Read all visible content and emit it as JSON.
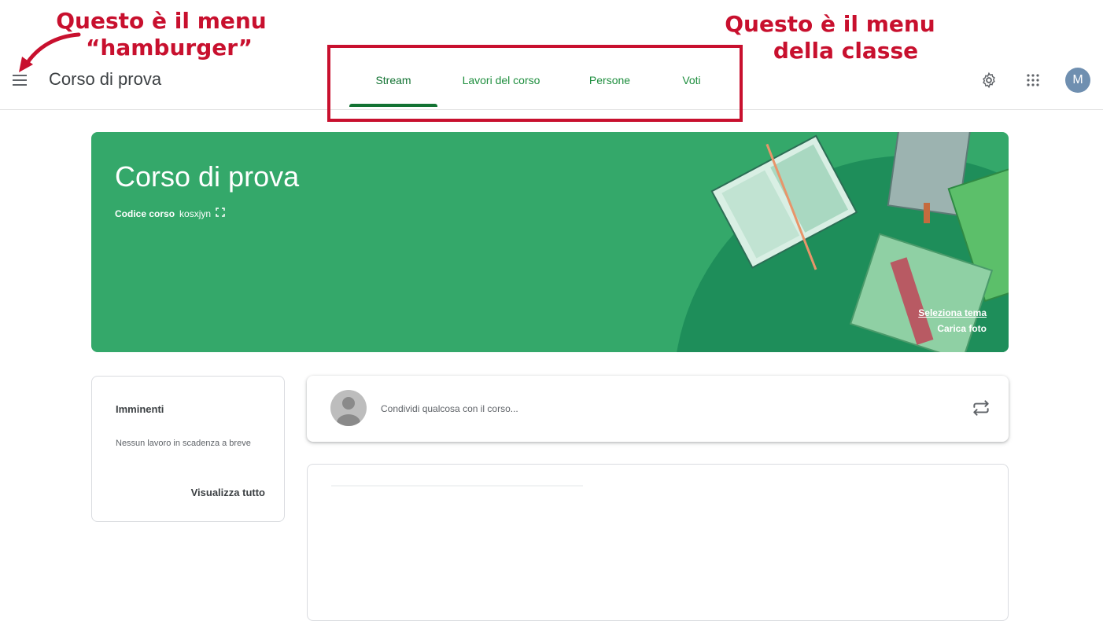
{
  "annotations": {
    "hamburger_line1": "Questo è il menu",
    "hamburger_line2": "“hamburger”",
    "class_menu_line1": "Questo è il menu",
    "class_menu_line2": "della classe"
  },
  "header": {
    "course_title": "Corso di prova",
    "tabs": [
      {
        "label": "Stream",
        "active": true
      },
      {
        "label": "Lavori del corso",
        "active": false
      },
      {
        "label": "Persone",
        "active": false
      },
      {
        "label": "Voti",
        "active": false
      }
    ],
    "avatar_initial": "M",
    "icons": [
      "menu-icon",
      "gear-icon",
      "apps-grid-icon"
    ]
  },
  "banner": {
    "title": "Corso di prova",
    "code_label": "Codice corso",
    "code_value": "kosxjyn",
    "select_theme": "Seleziona tema",
    "upload_photo": "Carica foto",
    "color": "#34a86a"
  },
  "upcoming": {
    "title": "Imminenti",
    "text": "Nessun lavoro in scadenza a breve",
    "link": "Visualizza tutto"
  },
  "share": {
    "placeholder": "Condividi qualcosa con il corso..."
  },
  "colors": {
    "accent": "#137333",
    "annotation": "#c8102e"
  }
}
